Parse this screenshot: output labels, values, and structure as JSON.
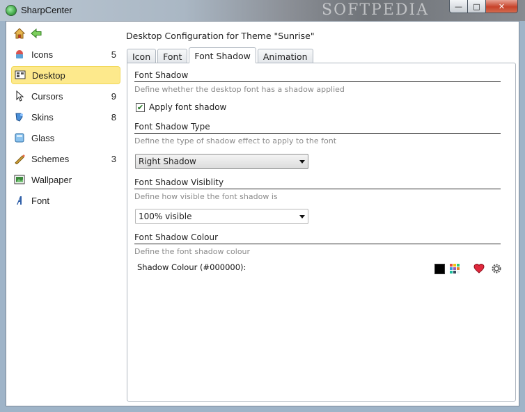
{
  "window": {
    "title": "SharpCenter",
    "watermark": "SOFTPEDIA",
    "minimize_glyph": "—",
    "maximize_glyph": "□",
    "close_glyph": "✕"
  },
  "sidebar": {
    "items": [
      {
        "label": "Icons",
        "count": "5",
        "icon": "icons-icon"
      },
      {
        "label": "Desktop",
        "count": "",
        "icon": "desktop-icon"
      },
      {
        "label": "Cursors",
        "count": "9",
        "icon": "cursor-icon"
      },
      {
        "label": "Skins",
        "count": "8",
        "icon": "skins-icon"
      },
      {
        "label": "Glass",
        "count": "",
        "icon": "glass-icon"
      },
      {
        "label": "Schemes",
        "count": "3",
        "icon": "schemes-icon"
      },
      {
        "label": "Wallpaper",
        "count": "",
        "icon": "wallpaper-icon"
      },
      {
        "label": "Font",
        "count": "",
        "icon": "font-icon"
      }
    ]
  },
  "main": {
    "heading": "Desktop Configuration for Theme \"Sunrise\"",
    "tabs": [
      {
        "label": "Icon"
      },
      {
        "label": "Font"
      },
      {
        "label": "Font Shadow"
      },
      {
        "label": "Animation"
      }
    ],
    "sections": {
      "shadow": {
        "title": "Font Shadow",
        "desc": "Define whether the desktop font has a shadow applied",
        "checkbox_label": "Apply font shadow"
      },
      "type": {
        "title": "Font Shadow Type",
        "desc": "Define the type of shadow effect to apply to the font",
        "value": "Right Shadow"
      },
      "visibility": {
        "title": "Font Shadow Visiblity",
        "desc": "Define how visible the font shadow is",
        "value": "100% visible"
      },
      "colour": {
        "title": "Font Shadow Colour",
        "desc": "Define the font shadow colour",
        "label": "Shadow Colour (#000000):"
      }
    }
  },
  "colors": {
    "active_sidebar": "#fde98c",
    "shadow_colour": "#000000"
  }
}
